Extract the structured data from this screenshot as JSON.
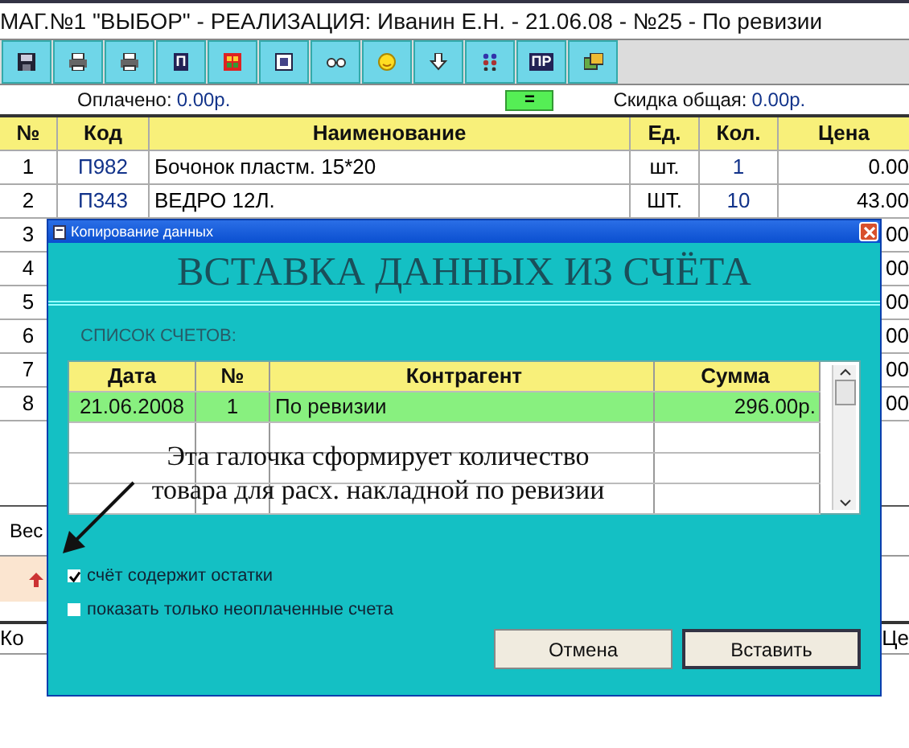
{
  "window": {
    "title": "МАГ.№1 \"ВЫБОР\" - РЕАЛИЗАЦИЯ: Иванин Е.Н. - 21.06.08 - №25 - По ревизии"
  },
  "toolbar": [
    {
      "kind": "icon"
    },
    {
      "kind": "icon"
    },
    {
      "kind": "icon"
    },
    {
      "kind": "text",
      "label": "П"
    },
    {
      "kind": "icon"
    },
    {
      "kind": "icon"
    },
    {
      "kind": "icon"
    },
    {
      "kind": "icon"
    },
    {
      "kind": "icon"
    },
    {
      "kind": "icon"
    },
    {
      "kind": "text",
      "label": "ПР"
    },
    {
      "kind": "icon"
    }
  ],
  "status": {
    "paid_label": "Оплачено:",
    "paid_value": "0.00р.",
    "equals_button": "=",
    "discount_label": "Скидка общая:",
    "discount_value": "0.00р."
  },
  "table": {
    "columns": [
      "№",
      "Код",
      "Наименование",
      "Ед.",
      "Кол.",
      "Цена"
    ],
    "rows": [
      {
        "cells": [
          "1",
          "П982",
          "Бочонок пластм. 15*20",
          "шт.",
          "1",
          "0.00"
        ]
      },
      {
        "cells": [
          "2",
          "П343",
          "ВЕДРО   12Л.",
          "ШТ.",
          "10",
          "43.00"
        ]
      },
      {
        "cells": [
          "3",
          "",
          "",
          "",
          "",
          "00"
        ]
      },
      {
        "cells": [
          "4",
          "",
          "",
          "",
          "",
          "00"
        ]
      },
      {
        "cells": [
          "5",
          "",
          "",
          "",
          "",
          "00"
        ]
      },
      {
        "cells": [
          "6",
          "",
          "",
          "",
          "",
          "00"
        ]
      },
      {
        "cells": [
          "7",
          "",
          "",
          "",
          "",
          "00"
        ]
      },
      {
        "cells": [
          "8",
          "",
          "",
          "",
          "",
          "00"
        ]
      }
    ]
  },
  "weight_label": "Вес",
  "lower_table": {
    "columns": [
      "Ко",
      "Це"
    ]
  },
  "dialog": {
    "title": "Копирование данных",
    "heading": "ВСТАВКА ДАННЫХ ИЗ СЧЁТА",
    "list_label": "СПИСОК СЧЕТОВ:",
    "columns": [
      "Дата",
      "№",
      "Контрагент",
      "Сумма"
    ],
    "rows": [
      {
        "cells": [
          "21.06.2008",
          "1",
          "По ревизии",
          "296.00р."
        ],
        "selected": true
      }
    ],
    "annotation": [
      "Эта галочка сформирует количество",
      "товара для расх. накладной по ревизии"
    ],
    "checkboxes": [
      {
        "label": "счёт содержит остатки",
        "checked": true
      },
      {
        "label": "показать только неоплаченные счета",
        "checked": false
      }
    ],
    "buttons": [
      "Отмена",
      "Вставить"
    ]
  }
}
